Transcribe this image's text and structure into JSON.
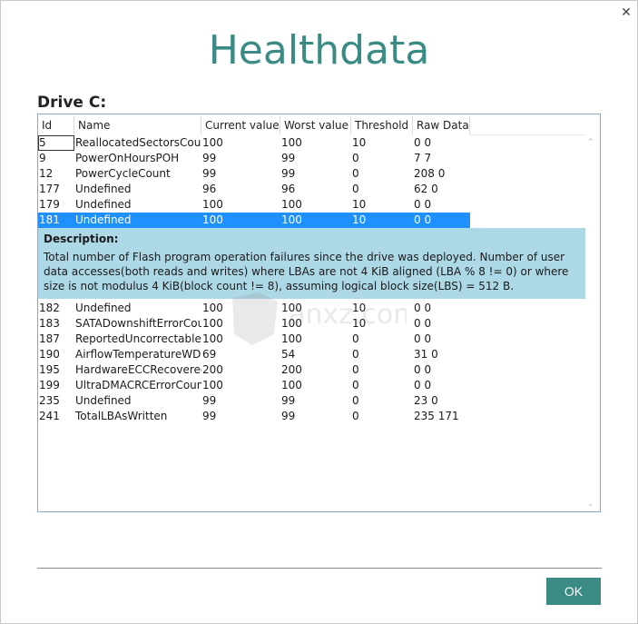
{
  "window": {
    "close_glyph": "✕"
  },
  "title": "Healthdata",
  "drive_label": "Drive C:",
  "columns": [
    "Id",
    "Name",
    "Current value",
    "Worst value",
    "Threshold",
    "Raw Data"
  ],
  "rows_before": [
    {
      "id": "5",
      "name": "ReallocatedSectorsCoun",
      "current": "100",
      "worst": "100",
      "threshold": "10",
      "raw": "0 0"
    },
    {
      "id": "9",
      "name": "PowerOnHoursPOH",
      "current": "99",
      "worst": "99",
      "threshold": "0",
      "raw": "7 7"
    },
    {
      "id": "12",
      "name": "PowerCycleCount",
      "current": "99",
      "worst": "99",
      "threshold": "0",
      "raw": "208 0"
    },
    {
      "id": "177",
      "name": "Undefined",
      "current": "96",
      "worst": "96",
      "threshold": "0",
      "raw": "62 0"
    },
    {
      "id": "179",
      "name": "Undefined",
      "current": "100",
      "worst": "100",
      "threshold": "10",
      "raw": "0 0"
    },
    {
      "id": "181",
      "name": "Undefined",
      "current": "100",
      "worst": "100",
      "threshold": "10",
      "raw": "0 0"
    }
  ],
  "description": {
    "title": "Description:",
    "text": "Total number of Flash program operation failures since the drive was deployed. Number of user data accesses(both reads and writes) where LBAs are not 4 KiB aligned (LBA % 8 != 0) or where size is not modulus 4 KiB(block count != 8), assuming logical block size(LBS) = 512 B."
  },
  "rows_after": [
    {
      "id": "182",
      "name": "Undefined",
      "current": "100",
      "worst": "100",
      "threshold": "10",
      "raw": "0 0"
    },
    {
      "id": "183",
      "name": "SATADownshiftErrorCou",
      "current": "100",
      "worst": "100",
      "threshold": "10",
      "raw": "0 0"
    },
    {
      "id": "187",
      "name": "ReportedUncorrectableE",
      "current": "100",
      "worst": "100",
      "threshold": "0",
      "raw": "0 0"
    },
    {
      "id": "190",
      "name": "AirflowTemperatureWD",
      "current": "69",
      "worst": "54",
      "threshold": "0",
      "raw": "31 0"
    },
    {
      "id": "195",
      "name": "HardwareECCRecovered",
      "current": "200",
      "worst": "200",
      "threshold": "0",
      "raw": "0 0"
    },
    {
      "id": "199",
      "name": "UltraDMACRCErrorCoun",
      "current": "100",
      "worst": "100",
      "threshold": "0",
      "raw": "0 0"
    },
    {
      "id": "235",
      "name": "Undefined",
      "current": "99",
      "worst": "99",
      "threshold": "0",
      "raw": "23 0"
    },
    {
      "id": "241",
      "name": "TotalLBAsWritten",
      "current": "99",
      "worst": "99",
      "threshold": "0",
      "raw": "235 171"
    }
  ],
  "selected_id": "181",
  "ok_label": "OK",
  "colors": {
    "accent": "#3a8b84",
    "selection": "#1e90ff",
    "description_bg": "#add8e6"
  }
}
